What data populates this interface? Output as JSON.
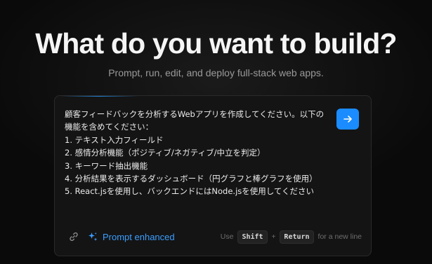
{
  "hero": {
    "title": "What do you want to build?",
    "subtitle": "Prompt, run, edit, and deploy full-stack web apps."
  },
  "prompt": {
    "text": "顧客フィードバックを分析するWebアプリを作成してください。以下の機能を含めてください：\n1. テキスト入力フィールド\n2. 感情分析機能（ポジティブ/ネガティブ/中立を判定）\n3. キーワード抽出機能\n4. 分析結果を表示するダッシュボード（円グラフと棒グラフを使用）\n5. React.jsを使用し、バックエンドにはNode.jsを使用してください",
    "send_icon": "arrow-right-icon"
  },
  "footer": {
    "link_icon": "link-icon",
    "enhance_icon": "sparkles-icon",
    "enhance_label": "Prompt enhanced",
    "hint_use": "Use",
    "hint_key_shift": "Shift",
    "hint_plus": "+",
    "hint_key_return": "Return",
    "hint_suffix": "for a new line"
  },
  "colors": {
    "background": "#0a0a0a",
    "card": "#141414",
    "accent": "#1a8cff",
    "accent_text": "#3b9eff"
  }
}
